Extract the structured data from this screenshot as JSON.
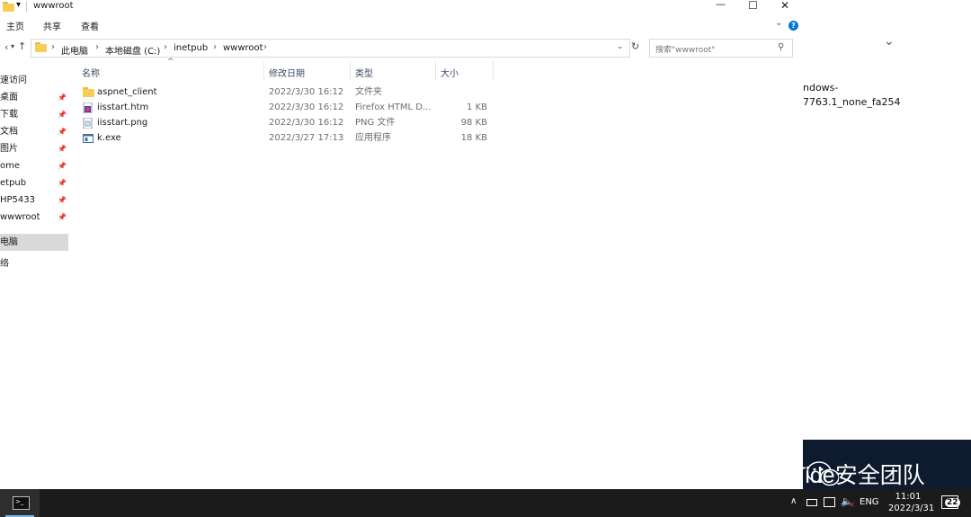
{
  "window": {
    "title": "wwwroot",
    "minimize_glyph": "—",
    "maximize_glyph": "☐",
    "close_glyph": "✕"
  },
  "ribbon": {
    "tabs": [
      "主页",
      "共享",
      "查看"
    ]
  },
  "address": {
    "breadcrumbs": [
      "此电脑",
      "本地磁盘 (C:)",
      "inetpub",
      "wwwroot"
    ],
    "search_placeholder": "搜索\"wwwroot\""
  },
  "nav": {
    "items": [
      {
        "label": "速访问",
        "pinned": false
      },
      {
        "label": "桌面",
        "pinned": true
      },
      {
        "label": "下载",
        "pinned": true
      },
      {
        "label": "文档",
        "pinned": true
      },
      {
        "label": "图片",
        "pinned": true
      },
      {
        "label": "ome",
        "pinned": true
      },
      {
        "label": "etpub",
        "pinned": true
      },
      {
        "label": "HP5433",
        "pinned": true
      },
      {
        "label": "wwwroot",
        "pinned": true
      },
      {
        "label": "电脑",
        "pinned": false,
        "selected": true
      },
      {
        "label": "络",
        "pinned": false
      }
    ]
  },
  "columns": {
    "name": "名称",
    "date": "修改日期",
    "type": "类型",
    "size": "大小"
  },
  "files": [
    {
      "name": "aspnet_client",
      "date": "2022/3/30 16:12",
      "type": "文件夹",
      "size": "",
      "icon": "folder-icon"
    },
    {
      "name": "iisstart.htm",
      "date": "2022/3/30 16:12",
      "type": "Firefox HTML D...",
      "size": "1 KB",
      "icon": "html-file-icon"
    },
    {
      "name": "iisstart.png",
      "date": "2022/3/30 16:12",
      "type": "PNG 文件",
      "size": "98 KB",
      "icon": "image-file-icon"
    },
    {
      "name": "k.exe",
      "date": "2022/3/27 17:13",
      "type": "应用程序",
      "size": "18 KB",
      "icon": "exe-file-icon"
    }
  ],
  "right_snippet": {
    "line1": "ndows-",
    "line2": "7763.1_none_fa254"
  },
  "watermark": {
    "text": "Tide安全团队"
  },
  "taskbar": {
    "lang": "ENG",
    "time": "11:01",
    "date": "2022/3/31",
    "notifications": "22"
  },
  "colors": {
    "accent": "#0078d7",
    "folder": "#f6cd55",
    "taskbar": "#1b1b1b",
    "selected": "#d9d9d9"
  }
}
